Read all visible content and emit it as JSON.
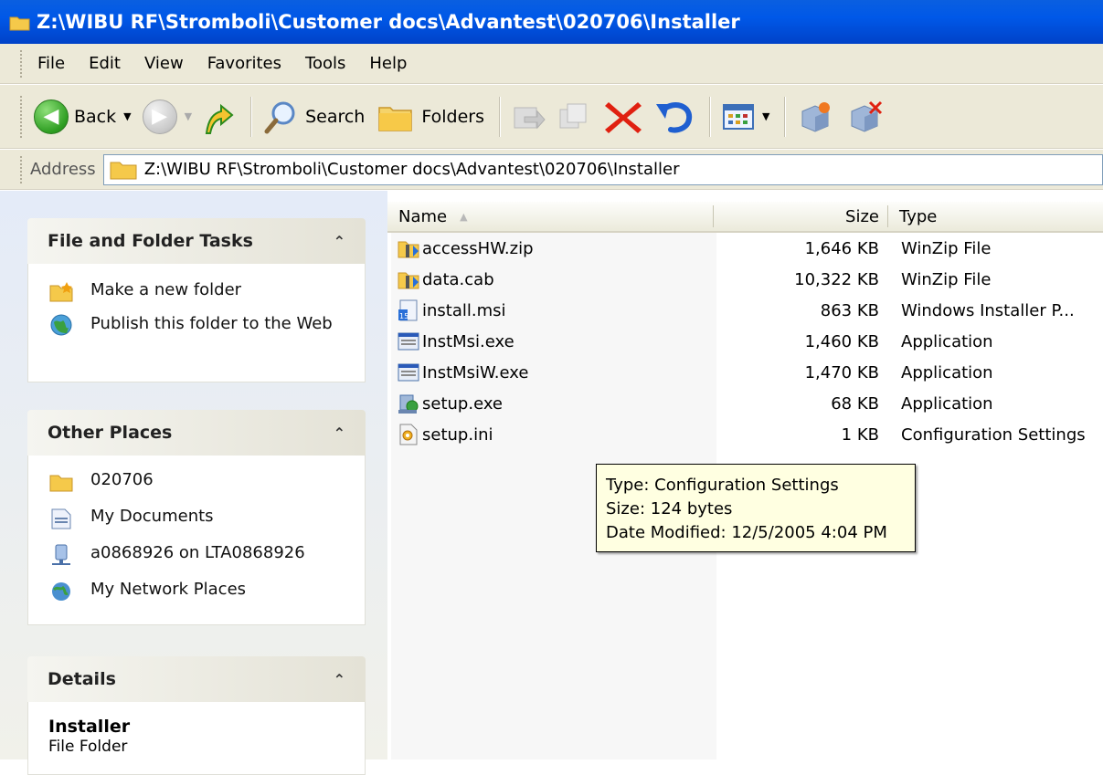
{
  "window": {
    "title": "Z:\\WIBU RF\\Stromboli\\Customer docs\\Advantest\\020706\\Installer"
  },
  "menu": {
    "items": [
      "File",
      "Edit",
      "View",
      "Favorites",
      "Tools",
      "Help"
    ]
  },
  "toolbar": {
    "back_label": "Back",
    "search_label": "Search",
    "folders_label": "Folders"
  },
  "address": {
    "label": "Address",
    "value": "Z:\\WIBU RF\\Stromboli\\Customer docs\\Advantest\\020706\\Installer"
  },
  "tasks_panel": {
    "title": "File and Folder Tasks",
    "items": [
      {
        "label": "Make a new folder",
        "icon": "new-folder-icon"
      },
      {
        "label": "Publish this folder to the Web",
        "icon": "publish-web-icon"
      }
    ]
  },
  "places_panel": {
    "title": "Other Places",
    "items": [
      {
        "label": "020706",
        "icon": "folder-icon"
      },
      {
        "label": "My Documents",
        "icon": "my-documents-icon"
      },
      {
        "label": "a0868926 on LTA0868926",
        "icon": "network-drive-icon"
      },
      {
        "label": "My Network Places",
        "icon": "network-places-icon"
      }
    ]
  },
  "details_panel": {
    "title": "Details",
    "name": "Installer",
    "type": "File Folder"
  },
  "file_list": {
    "columns": {
      "name": "Name",
      "size": "Size",
      "type": "Type"
    },
    "rows": [
      {
        "name": "accessHW.zip",
        "size": "1,646 KB",
        "type": "WinZip File",
        "icon": "zip-icon"
      },
      {
        "name": "data.cab",
        "size": "10,322 KB",
        "type": "WinZip File",
        "icon": "zip-icon"
      },
      {
        "name": "install.msi",
        "size": "863 KB",
        "type": "Windows Installer P...",
        "icon": "msi-icon"
      },
      {
        "name": "InstMsi.exe",
        "size": "1,460 KB",
        "type": "Application",
        "icon": "exe-icon"
      },
      {
        "name": "InstMsiW.exe",
        "size": "1,470 KB",
        "type": "Application",
        "icon": "exe-icon"
      },
      {
        "name": "setup.exe",
        "size": "68 KB",
        "type": "Application",
        "icon": "setup-icon"
      },
      {
        "name": "setup.ini",
        "size": "1 KB",
        "type": "Configuration Settings",
        "icon": "ini-icon"
      }
    ]
  },
  "tooltip": {
    "line1": "Type: Configuration Settings",
    "line2": "Size: 124 bytes",
    "line3": "Date Modified: 12/5/2005 4:04 PM"
  },
  "colors": {
    "titlebar": "#0058e8",
    "chrome": "#ece9d8",
    "tooltip_bg": "#ffffe1",
    "delete_red": "#e02010"
  }
}
